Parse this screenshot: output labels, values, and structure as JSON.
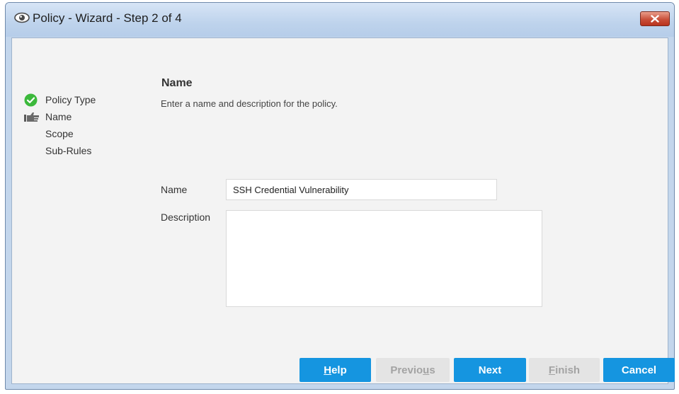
{
  "window": {
    "title": "Policy - Wizard - Step 2 of 4"
  },
  "steps": [
    {
      "label": "Policy Type",
      "status": "complete",
      "icon": "check-circle-icon"
    },
    {
      "label": "Name",
      "status": "current",
      "icon": "pointing-hand-icon"
    },
    {
      "label": "Scope",
      "status": "pending",
      "icon": ""
    },
    {
      "label": "Sub-Rules",
      "status": "pending",
      "icon": ""
    }
  ],
  "section": {
    "title": "Name",
    "subtitle": "Enter a name and description for the policy."
  },
  "form": {
    "name_label": "Name",
    "name_value": "SSH Credential Vulnerability",
    "description_label": "Description",
    "description_value": ""
  },
  "buttons": {
    "help": {
      "pre": "",
      "mn": "H",
      "post": "elp"
    },
    "previous": {
      "pre": "Previo",
      "mn": "u",
      "post": "s"
    },
    "next": {
      "pre": "Next",
      "mn": "",
      "post": ""
    },
    "finish": {
      "pre": "",
      "mn": "F",
      "post": "inish"
    },
    "cancel": {
      "pre": "Cancel",
      "mn": "",
      "post": ""
    }
  },
  "colors": {
    "accent": "#1595e0",
    "check": "#3cb93c",
    "close": "#c9503a",
    "disabled_text": "#a3a3a3"
  }
}
